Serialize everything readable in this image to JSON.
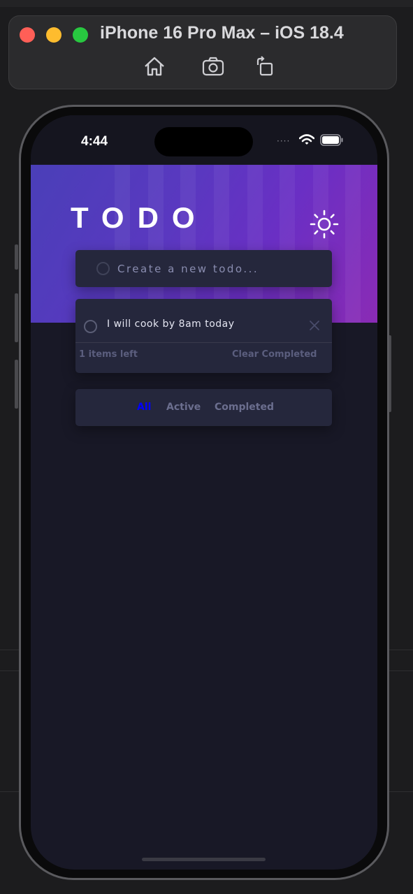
{
  "simulator": {
    "title": "iPhone 16 Pro Max – iOS 18.4",
    "buttons": [
      "home-icon",
      "screenshot-icon",
      "rotate-icon"
    ]
  },
  "status_bar": {
    "time": "4:44",
    "signal": "····"
  },
  "app": {
    "title": "TODO",
    "new_todo": {
      "placeholder": "Create a new todo..."
    },
    "todos": [
      {
        "text": "I will cook by 8am today",
        "completed": false
      }
    ],
    "footer": {
      "items_left": "1 items left",
      "clear_label": "Clear Completed"
    },
    "filters": [
      {
        "label": "All",
        "active": true
      },
      {
        "label": "Active",
        "active": false
      },
      {
        "label": "Completed",
        "active": false
      }
    ]
  },
  "colors": {
    "active_filter": "#0000ff",
    "inactive_filter": "#6b6e8e",
    "card": "#25273c",
    "background": "#181826"
  }
}
